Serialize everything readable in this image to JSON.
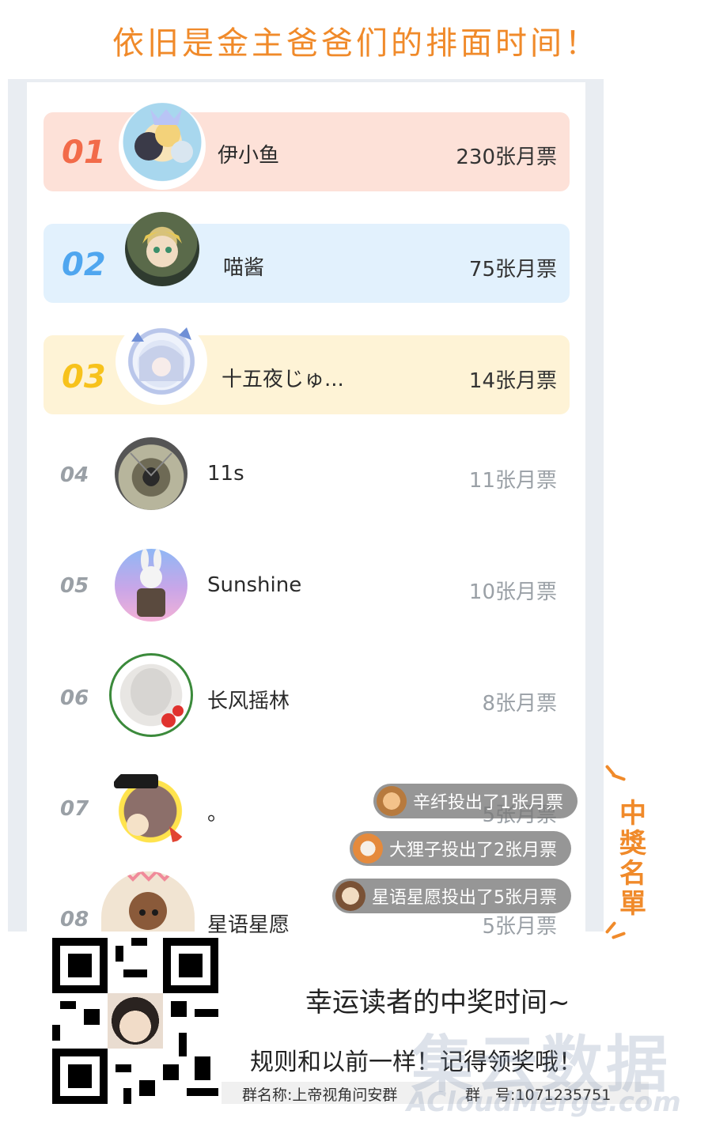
{
  "header": {
    "title": "依旧是金主爸爸们的排面时间！"
  },
  "leaderboard": [
    {
      "rank": "01",
      "name": "伊小鱼",
      "count": "230张月票",
      "rank_color": "#f26b4a"
    },
    {
      "rank": "02",
      "name": "喵酱",
      "count": "75张月票",
      "rank_color": "#4fa6ef"
    },
    {
      "rank": "03",
      "name": "十五夜じゅ...",
      "count": "14张月票",
      "rank_color": "#f7c21c"
    },
    {
      "rank": "04",
      "name": "11s",
      "count": "11张月票"
    },
    {
      "rank": "05",
      "name": "Sunshine",
      "count": "10张月票"
    },
    {
      "rank": "06",
      "name": "长风摇林",
      "count": "8张月票"
    },
    {
      "rank": "07",
      "name": "。",
      "count": "5张月票"
    },
    {
      "rank": "08",
      "name": "星语星愿",
      "count": "5张月票"
    }
  ],
  "toasts": [
    "辛纤投出了1张月票",
    "大狸子投出了2张月票",
    "星语星愿投出了5张月票"
  ],
  "side_label": "中獎名單",
  "footer": {
    "line1": "幸运读者的中奖时间~",
    "line2": "规则和以前一样！记得领奖哦！",
    "group_name": "群名称:上帝视角问安群",
    "group_number": "群　号:1071235751"
  },
  "watermark": {
    "line1": "集云数据",
    "line2": "ACloudMerge.com"
  }
}
